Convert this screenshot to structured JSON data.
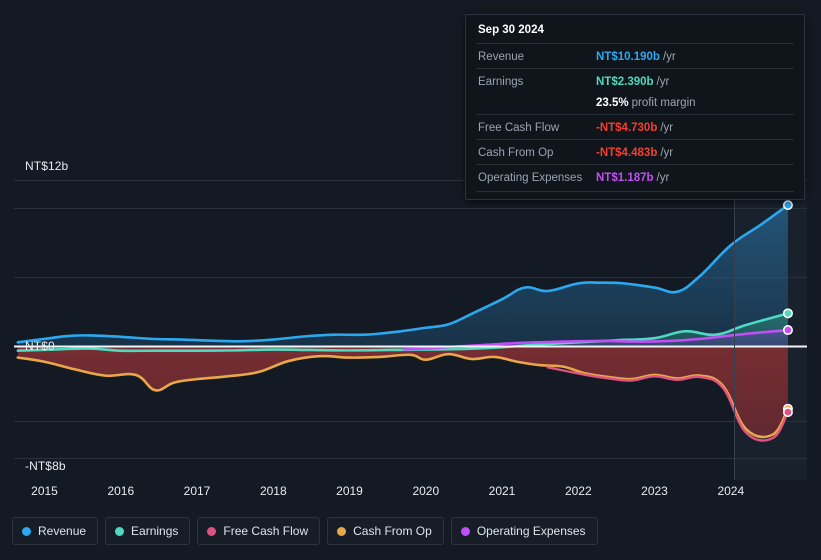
{
  "tooltip": {
    "date": "Sep 30 2024",
    "rows": [
      {
        "label": "Revenue",
        "value": "NT$10.190b",
        "suffix": "/yr",
        "color": "#2aa9f0"
      },
      {
        "label": "Earnings",
        "value": "NT$2.390b",
        "suffix": "/yr",
        "color": "#4fd9c0"
      },
      {
        "label": "",
        "value": "23.5%",
        "suffix": "profit margin",
        "color": "#ffffff"
      },
      {
        "label": "Free Cash Flow",
        "value": "-NT$4.730b",
        "suffix": "/yr",
        "color": "#f0402f"
      },
      {
        "label": "Cash From Op",
        "value": "-NT$4.483b",
        "suffix": "/yr",
        "color": "#f0402f"
      },
      {
        "label": "Operating Expenses",
        "value": "NT$1.187b",
        "suffix": "/yr",
        "color": "#c04ff5"
      }
    ]
  },
  "legend": {
    "items": [
      {
        "label": "Revenue",
        "color": "#2aa9f0"
      },
      {
        "label": "Earnings",
        "color": "#4fd9c0"
      },
      {
        "label": "Free Cash Flow",
        "color": "#e0527f"
      },
      {
        "label": "Cash From Op",
        "color": "#e8a84a"
      },
      {
        "label": "Operating Expenses",
        "color": "#c04ff5"
      }
    ]
  },
  "axes": {
    "y_top_label": "NT$12b",
    "y_zero_label": "NT$0",
    "y_bottom_label": "-NT$8b",
    "x_ticks": [
      "2015",
      "2016",
      "2017",
      "2018",
      "2019",
      "2020",
      "2021",
      "2022",
      "2023",
      "2024"
    ]
  },
  "chart_data": {
    "type": "area",
    "title": "",
    "xlabel": "",
    "ylabel": "NT$",
    "currency": "NT$",
    "units": "billions",
    "ylim": [
      -8,
      12
    ],
    "xlim": [
      2014.6,
      2025.0
    ],
    "grid": true,
    "legend_position": "bottom-left",
    "forecast_start": 2024.4,
    "y_gridlines": [
      12,
      10,
      5,
      0,
      -5.4,
      -8
    ],
    "series": [
      {
        "name": "Revenue",
        "color": "#2aa9f0",
        "fill": "rgba(35,105,160,0.40)",
        "x": [
          2014.65,
          2015.0,
          2015.3,
          2015.6,
          2016.0,
          2016.4,
          2016.8,
          2017.2,
          2017.6,
          2018.0,
          2018.4,
          2018.8,
          2019.2,
          2019.6,
          2020.0,
          2020.3,
          2020.6,
          2021.0,
          2021.3,
          2021.6,
          2022.0,
          2022.3,
          2022.6,
          2023.0,
          2023.3,
          2023.6,
          2024.0,
          2024.4,
          2024.75
        ],
        "y": [
          0.3,
          0.55,
          0.75,
          0.8,
          0.7,
          0.55,
          0.5,
          0.42,
          0.38,
          0.5,
          0.72,
          0.85,
          0.85,
          1.05,
          1.35,
          1.6,
          2.35,
          3.4,
          4.25,
          4.0,
          4.55,
          4.6,
          4.55,
          4.25,
          3.95,
          5.1,
          7.3,
          8.8,
          10.19
        ]
      },
      {
        "name": "Earnings",
        "color": "#4fd9c0",
        "fill": "rgba(45,140,125,0.35)",
        "x": [
          2014.65,
          2015.2,
          2015.6,
          2016.0,
          2016.5,
          2017.0,
          2017.5,
          2018.0,
          2018.5,
          2019.0,
          2019.5,
          2020.0,
          2020.5,
          2021.0,
          2021.5,
          2022.0,
          2022.5,
          2023.0,
          2023.4,
          2023.8,
          2024.2,
          2024.75
        ],
        "y": [
          -0.3,
          -0.2,
          -0.15,
          -0.3,
          -0.3,
          -0.3,
          -0.28,
          -0.22,
          -0.25,
          -0.28,
          -0.25,
          -0.22,
          -0.18,
          -0.05,
          0.15,
          0.3,
          0.45,
          0.6,
          1.1,
          0.85,
          1.55,
          2.39
        ]
      },
      {
        "name": "Operating Expenses",
        "color": "#c04ff5",
        "fill": "rgba(95,70,170,0.35)",
        "x": [
          2019.72,
          2020.0,
          2020.4,
          2020.8,
          2021.2,
          2021.6,
          2022.0,
          2022.4,
          2022.8,
          2023.2,
          2023.6,
          2024.0,
          2024.4,
          2024.75
        ],
        "y": [
          -0.2,
          -0.15,
          0.0,
          0.12,
          0.25,
          0.32,
          0.38,
          0.4,
          0.35,
          0.4,
          0.55,
          0.8,
          1.02,
          1.187
        ]
      },
      {
        "name": "Cash From Op",
        "color": "#e8a84a",
        "fill": "rgba(128,48,48,0.58)",
        "x": [
          2014.65,
          2015.0,
          2015.4,
          2015.8,
          2016.2,
          2016.45,
          2016.7,
          2017.0,
          2017.4,
          2017.8,
          2018.2,
          2018.6,
          2019.0,
          2019.4,
          2019.8,
          2020.0,
          2020.3,
          2020.6,
          2020.9,
          2021.2,
          2021.5,
          2021.8,
          2022.1,
          2022.4,
          2022.7,
          2023.0,
          2023.3,
          2023.6,
          2023.9,
          2024.2,
          2024.55,
          2024.75
        ],
        "y": [
          -0.8,
          -1.1,
          -1.65,
          -2.1,
          -2.05,
          -3.15,
          -2.6,
          -2.35,
          -2.15,
          -1.85,
          -1.05,
          -0.7,
          -0.8,
          -0.75,
          -0.6,
          -0.95,
          -0.55,
          -0.9,
          -0.75,
          -1.1,
          -1.35,
          -1.45,
          -1.95,
          -2.2,
          -2.35,
          -2.05,
          -2.3,
          -2.1,
          -2.85,
          -5.95,
          -6.35,
          -4.483
        ]
      },
      {
        "name": "Free Cash Flow",
        "color": "#e0527f",
        "fill": "none",
        "x": [
          2021.6,
          2022.1,
          2022.4,
          2022.7,
          2023.0,
          2023.3,
          2023.6,
          2023.9,
          2024.2,
          2024.55,
          2024.75
        ],
        "y": [
          -1.5,
          -2.05,
          -2.3,
          -2.45,
          -2.15,
          -2.4,
          -2.2,
          -3.0,
          -6.2,
          -6.6,
          -4.73
        ]
      }
    ]
  }
}
